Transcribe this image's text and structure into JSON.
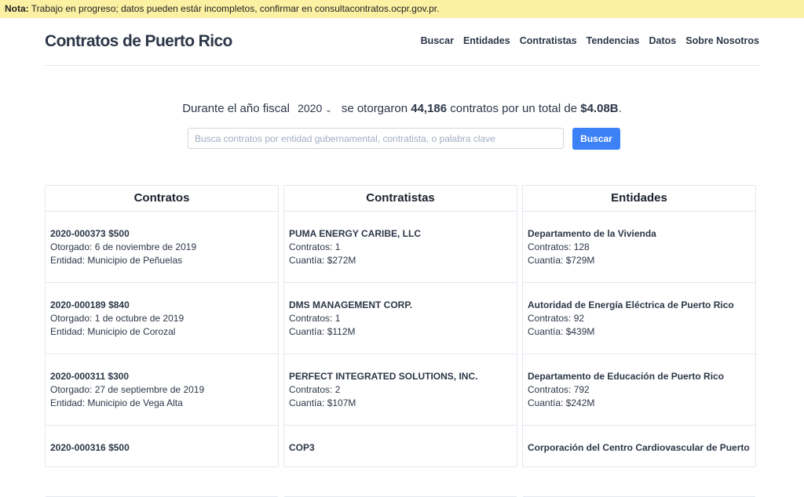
{
  "banner": {
    "label": "Nota:",
    "text": "Trabajo en progreso; datos pueden estár incompletos, confirmar en consultacontratos.ocpr.gov.pr."
  },
  "header": {
    "title": "Contratos de Puerto Rico",
    "nav": [
      "Buscar",
      "Entidades",
      "Contratistas",
      "Tendencias",
      "Datos",
      "Sobre Nosotros"
    ]
  },
  "summary": {
    "prefix": "Durante el año fiscal",
    "year": "2020",
    "mid": "se otorgaron",
    "count": "44,186",
    "mid2": "contratos por un total de",
    "total": "$4.08B",
    "suffix": "."
  },
  "search": {
    "placeholder": "Busca contratos por entidad gubernamental, contratista, o palabra clave",
    "button": "Buscar"
  },
  "contratos": {
    "heading": "Contratos",
    "items": [
      {
        "title": "2020-000373 $500",
        "line1": "Otorgado: 6 de noviembre de 2019",
        "line2": "Entidad: Municipio de Peñuelas"
      },
      {
        "title": "2020-000189 $840",
        "line1": "Otorgado: 1 de octubre de 2019",
        "line2": "Entidad: Municipio de Corozal"
      },
      {
        "title": "2020-000311 $300",
        "line1": "Otorgado: 27 de septiembre de 2019",
        "line2": "Entidad: Municipio de Vega Alta"
      },
      {
        "title": "2020-000316 $500",
        "line1": "",
        "line2": ""
      }
    ]
  },
  "contratistas": {
    "heading": "Contratistas",
    "items": [
      {
        "title": "PUMA ENERGY CARIBE, LLC",
        "line1": "Contratos: 1",
        "line2": "Cuantía: $272M"
      },
      {
        "title": "DMS MANAGEMENT CORP.",
        "line1": "Contratos: 1",
        "line2": "Cuantía: $112M"
      },
      {
        "title": "PERFECT INTEGRATED SOLUTIONS, INC.",
        "line1": "Contratos: 2",
        "line2": "Cuantía: $107M"
      },
      {
        "title": "COP3",
        "line1": "",
        "line2": ""
      }
    ]
  },
  "entidades": {
    "heading": "Entidades",
    "items": [
      {
        "title": "Departamento de la Vivienda",
        "line1": "Contratos: 128",
        "line2": "Cuantía: $729M"
      },
      {
        "title": "Autoridad de Energía Eléctrica de Puerto Rico",
        "line1": "Contratos: 92",
        "line2": "Cuantía: $439M"
      },
      {
        "title": "Departamento de Educación de Puerto Rico",
        "line1": "Contratos: 792",
        "line2": "Cuantía: $242M"
      },
      {
        "title": "Corporación del Centro Cardiovascular de Puerto",
        "line1": "",
        "line2": ""
      }
    ]
  }
}
